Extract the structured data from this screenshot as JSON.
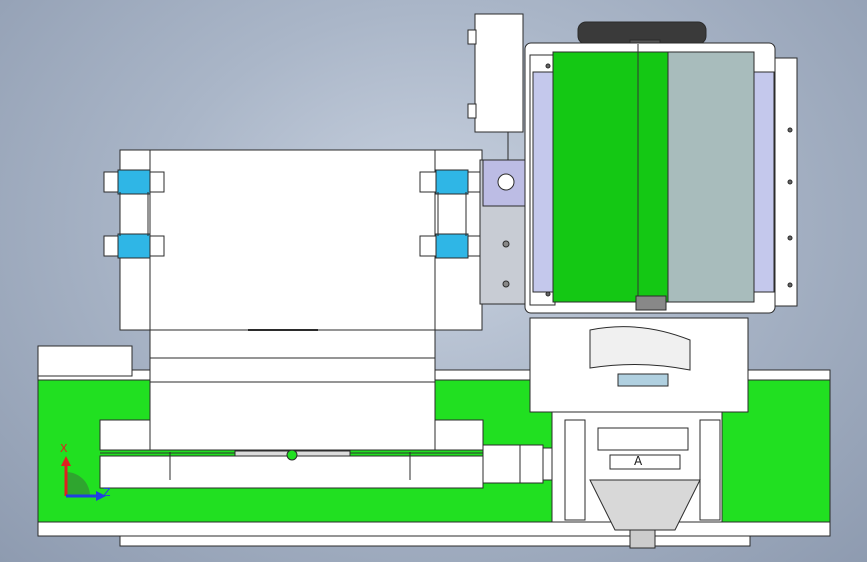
{
  "view": {
    "background_top": "#c9d2e0",
    "background_bottom": "#8e9bb0"
  },
  "colors": {
    "green_belt": "#21e021",
    "dark_green_panel": "#14c814",
    "light_gray_panel": "#a8bcbc",
    "lavender_panel": "#c4c8ec",
    "cyan_roller": "#2fb6e6",
    "outline": "#2b2b2b",
    "x_axis": "#e02020",
    "z_axis": "#2040e0"
  },
  "callout_label": "A",
  "triad": {
    "x_label": "X",
    "z_label": "Z",
    "icon": "coordinate-triad-icon"
  }
}
